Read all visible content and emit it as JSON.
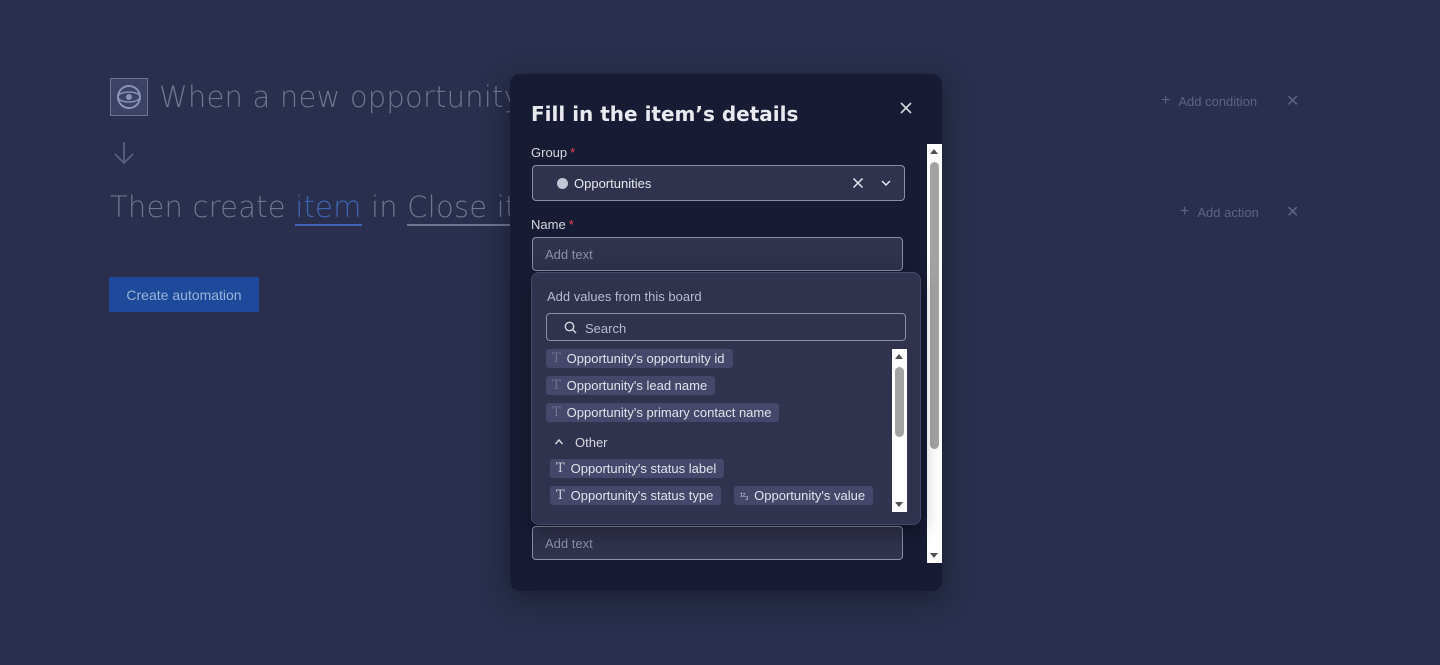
{
  "automation": {
    "trigger_sentence": "When a new opportunity i",
    "action_sentence": {
      "prefix": "Then create ",
      "item_token": "item",
      "middle": " in ",
      "board_token": "Close ite"
    },
    "add_condition": "Add condition",
    "add_action": "Add action",
    "create_button": "Create automation"
  },
  "modal": {
    "title": "Fill in the item’s details",
    "group_label": "Group",
    "group_value": "Opportunities",
    "name_label": "Name",
    "name_placeholder": "Add text",
    "bottom_placeholder": "Add text",
    "required_mark": "*"
  },
  "value_picker": {
    "title": "Add values from this board",
    "search_placeholder": "Search",
    "items": [
      {
        "label": "Opportunity's opportunity id",
        "icon": "text-icon"
      },
      {
        "label": "Opportunity's lead name",
        "icon": "text-icon"
      },
      {
        "label": "Opportunity's primary contact name",
        "icon": "text-icon"
      }
    ],
    "group_header": "Other",
    "other_items": [
      {
        "label": "Opportunity's status label",
        "icon": "text-icon"
      },
      {
        "label": "Opportunity's status type",
        "icon": "text-icon"
      },
      {
        "label": "Opportunity's value",
        "icon": "numbers-icon"
      }
    ],
    "text_icon_glyph": "T",
    "number_icon_glyph": "¹²₃"
  },
  "colors": {
    "background": "#292f4c",
    "modal": "#181b34",
    "popover": "#30324e",
    "accent": "#1e4a9c",
    "required": "#e2445c"
  }
}
